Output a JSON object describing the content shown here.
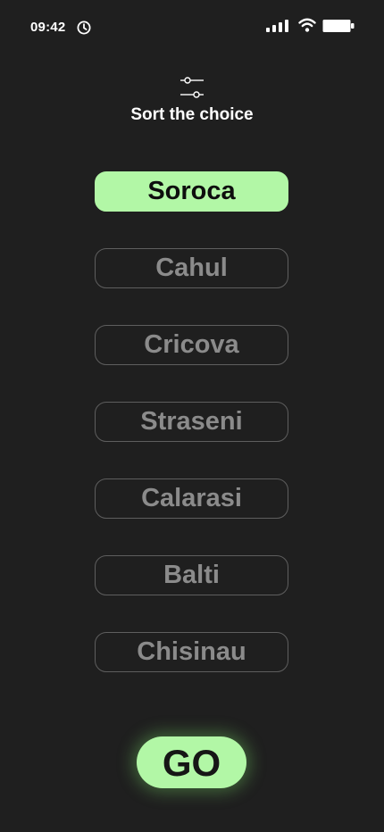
{
  "status_bar": {
    "time": "09:42",
    "icons": [
      "clock-icon",
      "signal-icon",
      "wifi-icon",
      "battery-icon"
    ]
  },
  "header": {
    "icon": "sort-sliders-icon",
    "title": "Sort the choice"
  },
  "choices": [
    {
      "label": "Soroca",
      "selected": true
    },
    {
      "label": "Cahul",
      "selected": false
    },
    {
      "label": "Cricova",
      "selected": false
    },
    {
      "label": "Straseni",
      "selected": false
    },
    {
      "label": "Calarasi",
      "selected": false
    },
    {
      "label": "Balti",
      "selected": false
    },
    {
      "label": "Chisinau",
      "selected": false
    }
  ],
  "go_button": {
    "label": "GO"
  },
  "colors": {
    "background": "#1f1f1f",
    "accent": "#b2f7a6",
    "inactive_text": "#8b8b8b",
    "inactive_border": "#5e5e5e"
  }
}
